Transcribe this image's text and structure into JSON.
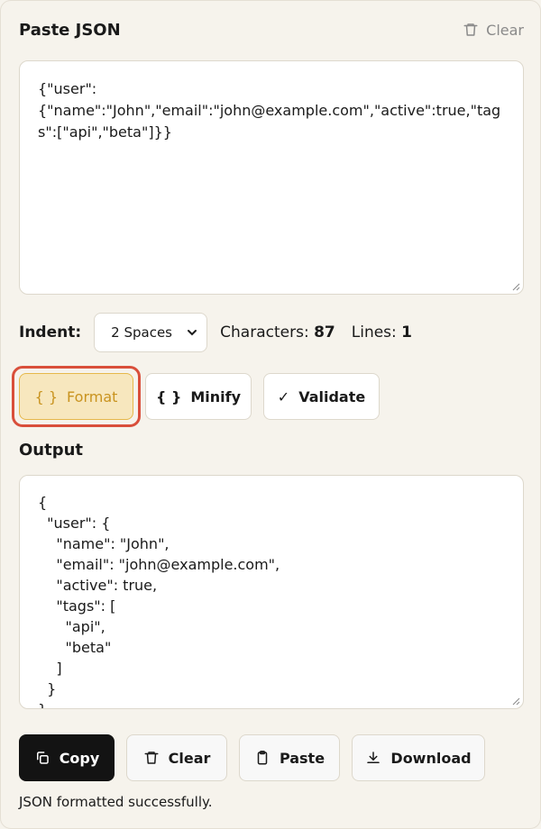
{
  "input_section": {
    "title": "Paste JSON",
    "clear_label": "Clear",
    "value": "{\"user\":\n{\"name\":\"John\",\"email\":\"john@example.com\",\"active\":true,\"tags\":[\"api\",\"beta\"]}}"
  },
  "controls": {
    "indent_label": "Indent:",
    "indent_selected": "2 Spaces",
    "characters_label": "Characters:",
    "characters_value": "87",
    "lines_label": "Lines:",
    "lines_value": "1"
  },
  "actions": {
    "format_label": "Format",
    "minify_label": "Minify",
    "validate_label": "Validate",
    "braces_glyph": "{ }",
    "check_glyph": "✓"
  },
  "output_section": {
    "title": "Output",
    "value": "{\n  \"user\": {\n    \"name\": \"John\",\n    \"email\": \"john@example.com\",\n    \"active\": true,\n    \"tags\": [\n      \"api\",\n      \"beta\"\n    ]\n  }\n}"
  },
  "output_actions": {
    "copy_label": "Copy",
    "clear_label": "Clear",
    "paste_label": "Paste",
    "download_label": "Download"
  },
  "status": "JSON formatted successfully.",
  "colors": {
    "accent_bg": "#f7e7be",
    "accent_text": "#c9931f",
    "highlight_ring": "#d94f3b",
    "primary_button": "#131313"
  }
}
